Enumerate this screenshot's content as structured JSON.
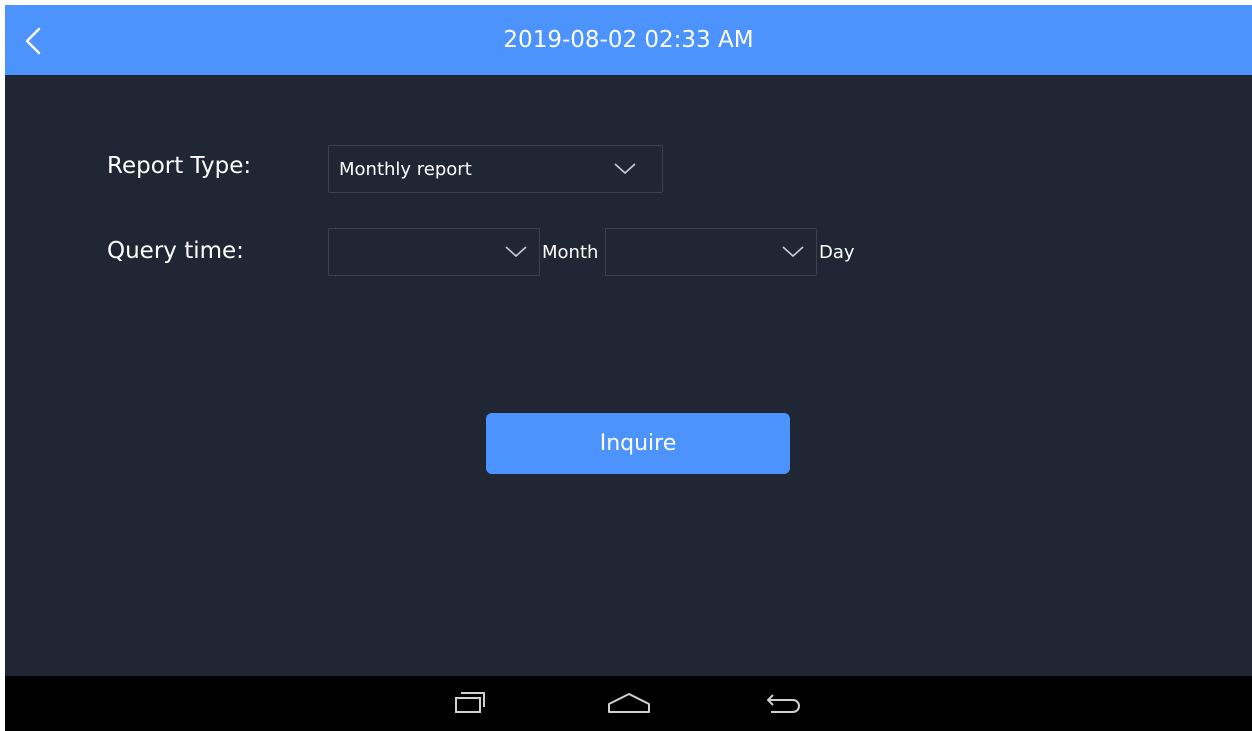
{
  "header": {
    "back_icon": "chevron-left-icon",
    "title": "2019-08-02 02:33 AM",
    "background_color": "#4c93fd"
  },
  "form": {
    "report_type": {
      "label": "Report Type:",
      "selected_value": "Monthly report",
      "icon": "chevron-down-icon"
    },
    "query_time": {
      "label": "Query time:",
      "month_value": "",
      "month_unit": "Month",
      "day_value": "",
      "day_unit": "Day",
      "icon": "chevron-down-icon"
    }
  },
  "actions": {
    "inquire_label": "Inquire",
    "button_color": "#4c93fd"
  },
  "navbar": {
    "recent_apps_icon": "recent-apps-icon",
    "home_icon": "home-icon",
    "back_icon": "back-arrow-icon"
  },
  "theme": {
    "background": "#212635",
    "text": "#ffffff"
  }
}
